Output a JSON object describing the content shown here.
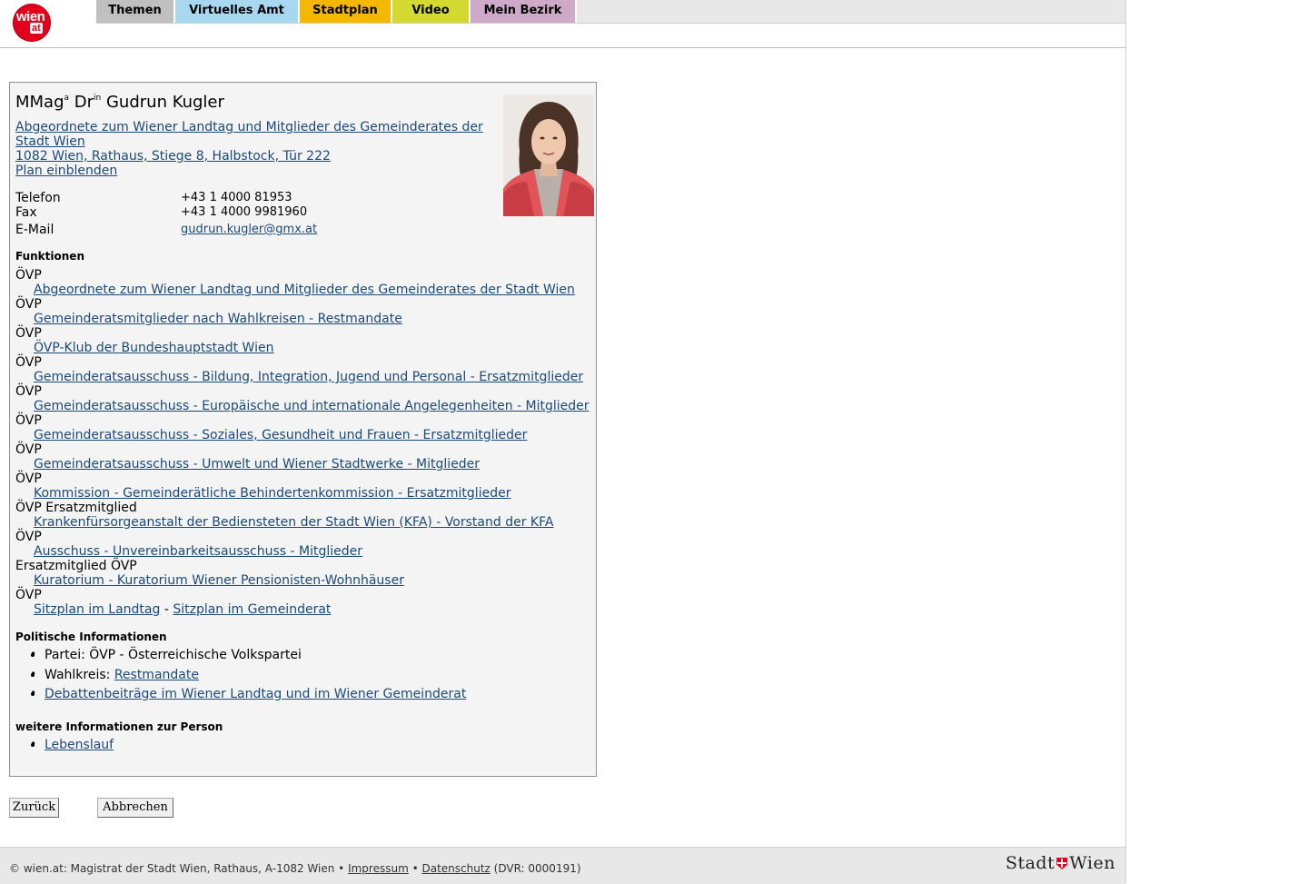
{
  "header": {
    "logo_top": "wien",
    "logo_bottom": "at",
    "tabs": [
      {
        "label": "Themen",
        "color": "#c0c0c0"
      },
      {
        "label": "Virtuelles Amt",
        "color": "#a8d8f0"
      },
      {
        "label": "Stadtplan",
        "color": "#f5b800"
      },
      {
        "label": "Video",
        "color": "#d4d932"
      },
      {
        "label": "Mein Bezirk",
        "color": "#cfa9c8"
      }
    ]
  },
  "person": {
    "title_prefix": "MMag",
    "title_sup1": "a",
    "title_mid": " Dr",
    "title_sup2": "in",
    "title_name": " Gudrun Kugler",
    "org_line1": "Abgeordnete zum Wiener Landtag und Mitglieder des Gemeinderates der",
    "org_line2": "Stadt Wien ",
    "address": "1082 Wien, Rathaus, Stiege 8, Halbstock, Tür 222",
    "plan_link": "Plan einblenden"
  },
  "contact": {
    "phone_label": "Telefon",
    "phone": "+43 1 4000 81953",
    "fax_label": "Fax",
    "fax": "+43 1 4000 9981960",
    "email_label": "E-Mail",
    "email": "gudrun.kugler@gmx.at"
  },
  "functions": {
    "heading": "Funktionen",
    "items": [
      {
        "party": "ÖVP",
        "link": "Abgeordnete zum Wiener Landtag und Mitglieder des Gemeinderates der Stadt Wien"
      },
      {
        "party": "ÖVP",
        "link": "Gemeinderatsmitglieder nach Wahlkreisen - Restmandate"
      },
      {
        "party": "ÖVP",
        "link": "ÖVP-Klub der Bundeshauptstadt Wien"
      },
      {
        "party": "ÖVP",
        "link": "Gemeinderatsausschuss - Bildung, Integration, Jugend und Personal - Ersatzmitglieder"
      },
      {
        "party": "ÖVP",
        "link": "Gemeinderatsausschuss - Europäische und internationale Angelegenheiten - Mitglieder"
      },
      {
        "party": "ÖVP",
        "link": "Gemeinderatsausschuss - Soziales, Gesundheit und Frauen - Ersatzmitglieder"
      },
      {
        "party": "ÖVP",
        "link": "Gemeinderatsausschuss - Umwelt und Wiener Stadtwerke - Mitglieder"
      },
      {
        "party": "ÖVP",
        "link": "Kommission - Gemeinderätliche Behindertenkommission - Ersatzmitglieder"
      },
      {
        "party": "ÖVP Ersatzmitglied",
        "link": "Krankenfürsorgeanstalt der Bediensteten der Stadt Wien (KFA) - Vorstand der KFA"
      },
      {
        "party": "ÖVP",
        "link": "Ausschuss - Unvereinbarkeitsausschuss - Mitglieder"
      },
      {
        "party": "Ersatzmitglied ÖVP",
        "link": "Kuratorium - Kuratorium Wiener Pensionisten-Wohnhäuser"
      }
    ],
    "last_party": "ÖVP",
    "seat_landtag": "Sitzplan im Landtag",
    "seat_sep": " - ",
    "seat_gemeinderat": "Sitzplan im Gemeinderat"
  },
  "politics": {
    "heading": "Politische Informationen",
    "party": "Partei: ÖVP - Österreichische Volkspartei",
    "wahlkreis_label": "Wahlkreis: ",
    "wahlkreis_link": "Restmandate",
    "debates_link": "Debattenbeiträge im Wiener Landtag und im Wiener Gemeinderat"
  },
  "more": {
    "heading": "weitere Informationen zur Person",
    "cv_link": "Lebenslauf"
  },
  "buttons": {
    "back": "Zurück",
    "cancel": "Abbrechen"
  },
  "footer": {
    "text_before": "© wien.at: Magistrat der Stadt Wien, Rathaus, A-1082 Wien • ",
    "impressum": "Impressum",
    "sep": " • ",
    "datenschutz": "Datenschutz",
    "dvr": " (DVR: 0000191)",
    "brand_left": "Stadt",
    "brand_right": "Wien"
  }
}
